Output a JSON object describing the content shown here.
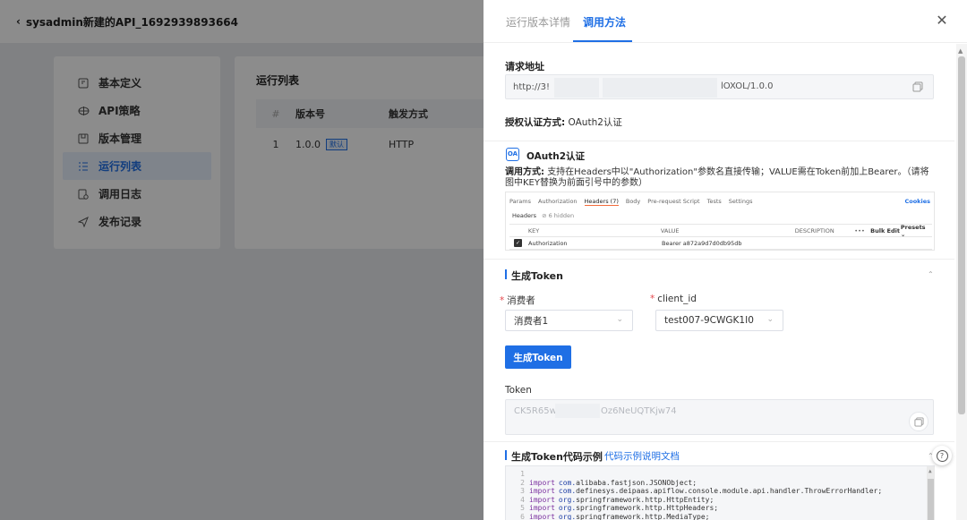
{
  "header": {
    "title": "sysadmin新建的API_1692939893664"
  },
  "nav": {
    "items": [
      {
        "label": "基本定义",
        "icon": "definition-icon",
        "active": false
      },
      {
        "label": "API策略",
        "icon": "strategy-icon",
        "active": false
      },
      {
        "label": "版本管理",
        "icon": "version-icon",
        "active": false
      },
      {
        "label": "运行列表",
        "icon": "list-icon",
        "active": true
      },
      {
        "label": "调用日志",
        "icon": "log-icon",
        "active": false
      },
      {
        "label": "发布记录",
        "icon": "publish-icon",
        "active": false
      }
    ]
  },
  "run_list": {
    "title": "运行列表",
    "columns": [
      "#",
      "版本号",
      "触发方式"
    ],
    "rows": [
      {
        "index": "1",
        "version": "1.0.0",
        "tag": "默认",
        "trigger": "HTTP"
      }
    ]
  },
  "drawer": {
    "tabs": [
      "运行版本详情",
      "调用方法"
    ],
    "active_tab": "调用方法",
    "request_url": {
      "label": "请求地址",
      "prefix": "http://3!",
      "suffix": "lOXOL/1.0.0"
    },
    "auth": {
      "label": "授权认证方式:",
      "value": "OAuth2认证"
    },
    "oauth": {
      "badge": "OA",
      "title": "OAuth2认证",
      "usage_label": "调用方式:",
      "usage_text": "支持在Headers中以\"Authorization\"参数名直接传输；VALUE需在Token前加上Bearer。（请将图中KEY替换为前面引号中的参数）"
    },
    "postman": {
      "tabs": [
        "Params",
        "Authorization",
        "Headers (7)",
        "Body",
        "Pre-request Script",
        "Tests",
        "Settings"
      ],
      "cookies": "Cookies",
      "headers_label": "Headers",
      "hidden": "⊘ 6 hidden",
      "columns": {
        "key": "KEY",
        "value": "VALUE",
        "description": "DESCRIPTION",
        "more": "•••",
        "bulk": "Bulk Edit",
        "presets": "Presets ⌄"
      },
      "row": {
        "key": "Authorization",
        "value": "Bearer a872a9d7d0db95db"
      }
    },
    "gen_token": {
      "title": "生成Token",
      "consumer_label": "消费者",
      "consumer_value": "消费者1",
      "client_label": "client_id",
      "client_value": "test007-9CWGK1I0",
      "button": "生成Token",
      "token_label": "Token",
      "token_a": "CK5R65w",
      "token_b": "Oz6NeUQTKjw74"
    },
    "code_example": {
      "title": "生成Token代码示例",
      "link": "代码示例说明文档",
      "lines": [
        {
          "n": "1",
          "kw": "",
          "pkg": "",
          "rest": ""
        },
        {
          "n": "2",
          "kw": "import",
          "pkg": "com.",
          "rest": "alibaba.fastjson.JSONObject;"
        },
        {
          "n": "3",
          "kw": "import",
          "pkg": "com.",
          "rest": "definesys.deipaas.apiflow.console.module.api.handler.ThrowErrorHandler;"
        },
        {
          "n": "4",
          "kw": "import",
          "pkg": "org.",
          "rest": "springframework.http.HttpEntity;"
        },
        {
          "n": "5",
          "kw": "import",
          "pkg": "org.",
          "rest": "springframework.http.HttpHeaders;"
        },
        {
          "n": "6",
          "kw": "import",
          "pkg": "org.",
          "rest": "springframework.http.MediaType;"
        }
      ]
    }
  },
  "colors": {
    "primary": "#1f6fe5",
    "required": "#e5484d",
    "overlay": "rgba(0,0,0,0.45)"
  }
}
